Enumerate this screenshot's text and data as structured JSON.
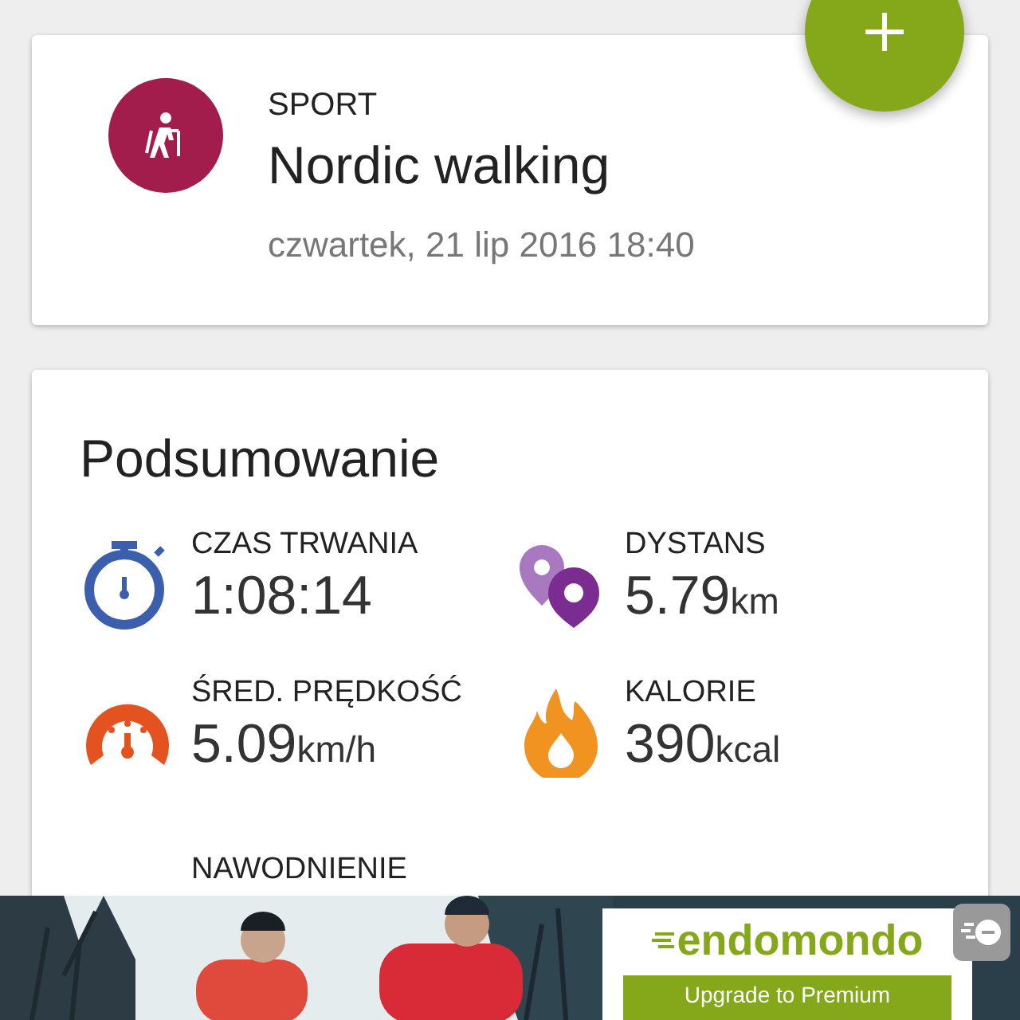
{
  "activity": {
    "label": "SPORT",
    "name": "Nordic walking",
    "date": "czwartek, 21 lip 2016 18:40",
    "color": "#a31d4c"
  },
  "summary": {
    "title": "Podsumowanie",
    "stats": [
      {
        "kind": "duration",
        "label": "CZAS TRWANIA",
        "value": "1:08:14"
      },
      {
        "kind": "distance",
        "label": "DYSTANS",
        "value": "5.79",
        "unit": "km"
      },
      {
        "kind": "speed",
        "label": "ŚRED. PRĘDKOŚĆ",
        "value": "5.09",
        "unit": "km/h"
      },
      {
        "kind": "calories",
        "label": "KALORIE",
        "value": "390",
        "unit": "kcal"
      },
      {
        "kind": "hydration",
        "label": "NAWODNIENIE"
      }
    ]
  },
  "ad": {
    "brand": "endomondo",
    "button": "Upgrade to Premium"
  }
}
